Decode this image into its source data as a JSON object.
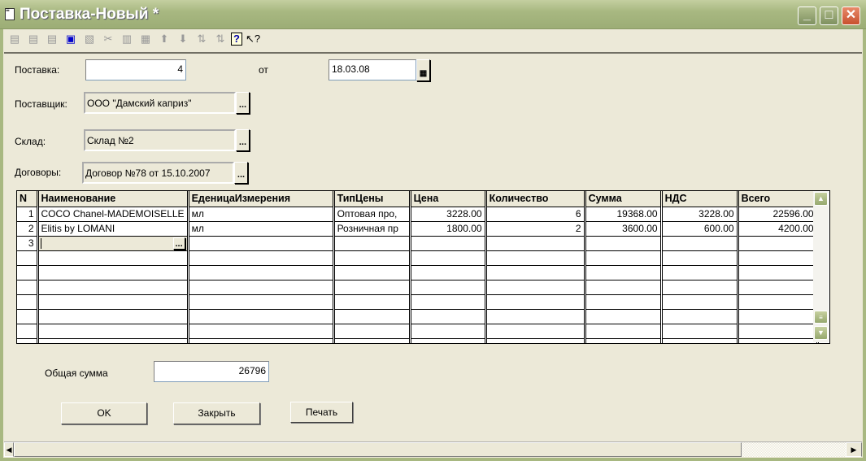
{
  "window": {
    "title": "Поставка-Новый *",
    "minimize": "_",
    "maximize": "□",
    "close": "✕"
  },
  "toolbar": {
    "icons": [
      "new-row-icon",
      "add-row-icon",
      "delete-row-icon",
      "save-icon",
      "copy-icon",
      "cut-icon",
      "edit-icon",
      "insert-icon",
      "move-up-icon",
      "move-down-icon",
      "sort-asc-icon",
      "sort-desc-icon",
      "help-icon",
      "context-help-icon"
    ]
  },
  "form": {
    "delivery_label": "Поставка:",
    "delivery_number": "4",
    "from_label": "от",
    "date": "18.03.08",
    "supplier_label": "Поставщик:",
    "supplier": "ООО \"Дамский каприз\"",
    "warehouse_label": "Склад:",
    "warehouse": "Склад №2",
    "contracts_label": "Договоры:",
    "contract": "Договор №78 от 15.10.2007",
    "ellipsis": "..."
  },
  "table": {
    "columns": [
      "N",
      "Наименование",
      "ЕденицаИзмерения",
      "ТипЦены",
      "Цена",
      "Количество",
      "Сумма",
      "НДС",
      "Всего"
    ],
    "rows": [
      [
        "1",
        "COCO Chanel-MADEMOISELLE",
        "мл",
        "Оптовая про,",
        "3228.00",
        "6",
        "19368.00",
        "3228.00",
        "22596.00"
      ],
      [
        "2",
        "Elitis by LOMANI",
        "мл",
        "Розничная пр",
        "1800.00",
        "2",
        "3600.00",
        "600.00",
        "4200.00"
      ],
      [
        "3",
        "",
        "",
        "",
        "",
        "",
        "",
        "",
        ""
      ]
    ]
  },
  "total": {
    "label": "Общая сумма",
    "value": "26796"
  },
  "buttons": {
    "ok": "OK",
    "close": "Закрыть",
    "print": "Печать"
  }
}
